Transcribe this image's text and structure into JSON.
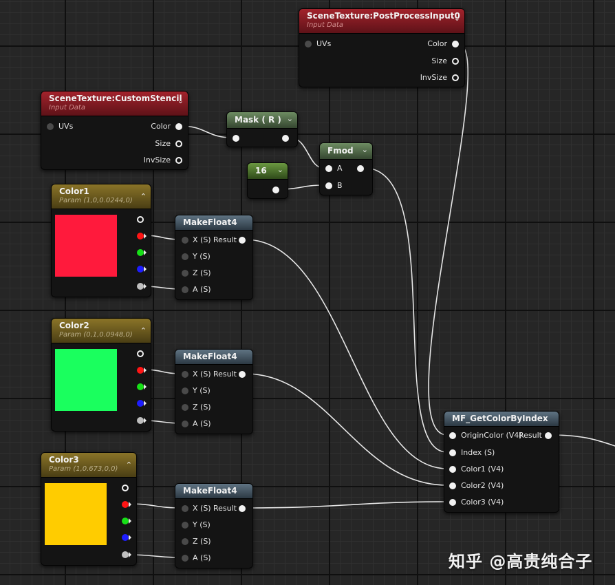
{
  "colors": {
    "color1": "#ff1a3c",
    "color2": "#1aff5e",
    "color3": "#ffcc00",
    "wire": "#e6e6e6"
  },
  "nodes": {
    "post_process": {
      "title": "SceneTexture:PostProcessInput0",
      "subtitle": "Input Data",
      "in_uvs": "UVs",
      "out_color": "Color",
      "out_size": "Size",
      "out_invsize": "InvSize"
    },
    "custom_stencil": {
      "title": "SceneTexture:CustomStencil",
      "subtitle": "Input Data",
      "in_uvs": "UVs",
      "out_color": "Color",
      "out_size": "Size",
      "out_invsize": "InvSize"
    },
    "mask": {
      "title": "Mask ( R )"
    },
    "fmod": {
      "title": "Fmod",
      "in_a": "A",
      "in_b": "B"
    },
    "const16": {
      "title": "16"
    },
    "color1": {
      "title": "Color1",
      "subtitle": "Param (1,0,0.0244,0)"
    },
    "color2": {
      "title": "Color2",
      "subtitle": "Param (0,1,0.0948,0)"
    },
    "color3": {
      "title": "Color3",
      "subtitle": "Param (1,0.673,0,0)"
    },
    "makefloat_1": {
      "title": "MakeFloat4",
      "x": "X (S)",
      "y": "Y (S)",
      "z": "Z (S)",
      "a": "A (S)",
      "result": "Result"
    },
    "makefloat_2": {
      "title": "MakeFloat4",
      "x": "X (S)",
      "y": "Y (S)",
      "z": "Z (S)",
      "a": "A (S)",
      "result": "Result"
    },
    "makefloat_3": {
      "title": "MakeFloat4",
      "x": "X (S)",
      "y": "Y (S)",
      "z": "Z (S)",
      "a": "A (S)",
      "result": "Result"
    },
    "get_color": {
      "title": "MF_GetColorByIndex",
      "in_origin": "OriginColor (V4)",
      "in_index": "Index (S)",
      "in_color1": "Color1 (V4)",
      "in_color2": "Color2 (V4)",
      "in_color3": "Color3 (V4)",
      "result": "Result"
    }
  },
  "watermark": "知乎 @高贵纯合子"
}
